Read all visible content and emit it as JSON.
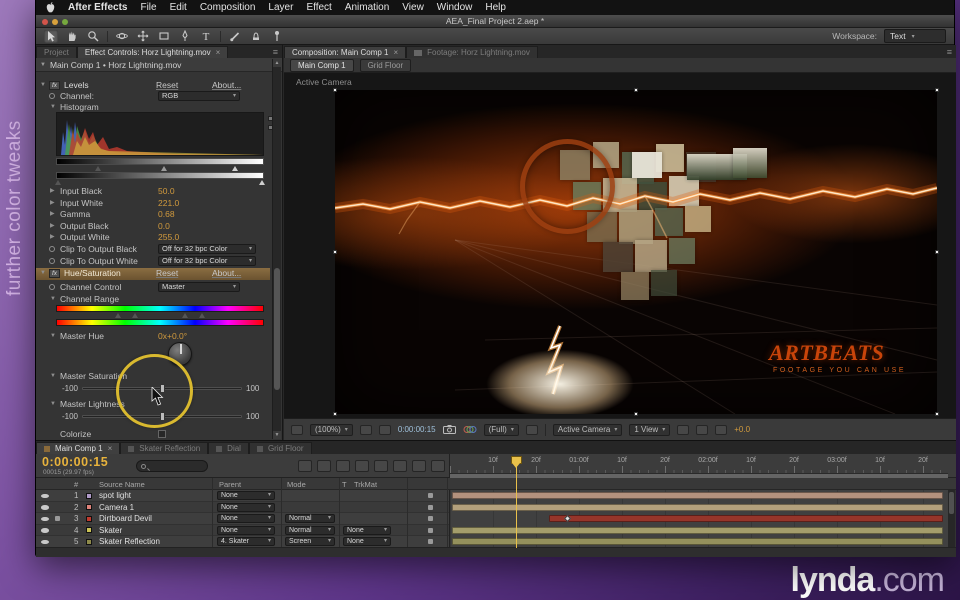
{
  "overlay": {
    "caption": "further color tweaks",
    "logo_main": "lynda",
    "logo_suffix": ".com"
  },
  "menubar": {
    "items": [
      "After Effects",
      "File",
      "Edit",
      "Composition",
      "Layer",
      "Effect",
      "Animation",
      "View",
      "Window",
      "Help"
    ]
  },
  "window": {
    "title": "AEA_Final Project 2.aep *"
  },
  "toolbar": {
    "workspace_label": "Workspace:",
    "workspace_value": "Text",
    "tools": [
      "selection-tool",
      "hand-tool",
      "zoom-tool",
      "orbit-camera-tool",
      "pan-behind-tool",
      "mask-shape-tool",
      "pen-tool",
      "type-tool",
      "brush-tool",
      "clone-stamp-tool",
      "puppet-pin-tool"
    ]
  },
  "effect_controls": {
    "tab_project": "Project",
    "tab_effect_controls": "Effect Controls: Horz Lightning.mov",
    "breadcrumb": "Main Comp 1 • Horz Lightning.mov",
    "levels": {
      "title": "Levels",
      "reset": "Reset",
      "about": "About...",
      "channel_label": "Channel:",
      "channel_value": "RGB",
      "histogram_label": "Histogram",
      "input_black_label": "Input Black",
      "input_black_value": "50.0",
      "input_white_label": "Input White",
      "input_white_value": "221.0",
      "gamma_label": "Gamma",
      "gamma_value": "0.68",
      "output_black_label": "Output Black",
      "output_black_value": "0.0",
      "output_white_label": "Output White",
      "output_white_value": "255.0",
      "clip_black_label": "Clip To Output Black",
      "clip_black_value": "Off for 32 bpc Color",
      "clip_white_label": "Clip To Output White",
      "clip_white_value": "Off for 32 bpc Color"
    },
    "hue_saturation": {
      "title": "Hue/Saturation",
      "reset": "Reset",
      "about": "About...",
      "channel_control_label": "Channel Control",
      "channel_control_value": "Master",
      "channel_range_label": "Channel Range",
      "master_hue_label": "Master Hue",
      "master_hue_value": "0x+0.0°",
      "master_saturation_label": "Master Saturation",
      "master_lightness_label": "Master Lightness",
      "slider_min": "-100",
      "slider_max": "100",
      "colorize_label": "Colorize"
    }
  },
  "composition": {
    "tab_active": "Composition: Main Comp 1",
    "tab_inactive": "Footage: Horz Lightning.mov",
    "nav_comp": "Main Comp 1",
    "nav_grid": "Grid Floor",
    "camera_label": "Active Camera",
    "watermark_title": "ARTBEATS",
    "watermark_subtitle": "FOOTAGE YOU CAN USE",
    "statusbar": {
      "zoom": "(100%)",
      "timecode": "0:00:00:15",
      "resolution": "(Full)",
      "camera": "Active Camera",
      "views": "1 View",
      "exposure": "+0.0"
    }
  },
  "timeline": {
    "tabs": [
      "Main Comp 1",
      "Skater Reflection",
      "Dial",
      "Grid Floor"
    ],
    "timecode": "0:00:00:15",
    "frame_info": "00015 (29.97 fps)",
    "columns": {
      "hash": "#",
      "source_name": "Source Name",
      "parent": "Parent",
      "mode": "Mode",
      "t": "T",
      "trkmat": "TrkMat"
    },
    "ruler_labels": [
      "10f",
      "20f",
      "01:00f",
      "10f",
      "20f",
      "02:00f",
      "10f",
      "20f",
      "03:00f",
      "10f",
      "20f"
    ],
    "layers": [
      {
        "num": "1",
        "name": "spot light",
        "parent": "None",
        "mode": "",
        "trkmat": "",
        "color": "#b09ac8",
        "bar_color": "#b3917d"
      },
      {
        "num": "2",
        "name": "Camera 1",
        "parent": "None",
        "mode": "",
        "trkmat": "",
        "color": "#e0837a",
        "bar_color": "#b3a07c"
      },
      {
        "num": "3",
        "name": "Dirtboard Devil",
        "parent": "None",
        "mode": "Normal",
        "trkmat": "",
        "color": "#c23b2e",
        "bar_color": "#96352a"
      },
      {
        "num": "4",
        "name": "Skater",
        "parent": "None",
        "mode": "Normal",
        "trkmat": "None",
        "color": "#cbc356",
        "bar_color": "#a49d6b"
      },
      {
        "num": "5",
        "name": "Skater Reflection",
        "parent": "4. Skater",
        "mode": "Screen",
        "trkmat": "None",
        "color": "#8e8a4a",
        "bar_color": "#94905c"
      }
    ]
  },
  "colors": {
    "value_accent": "#d19a3d",
    "timecode_accent": "#e8b33c",
    "annotation": "#d9b92f",
    "background_top": "#9d79bb",
    "background_bottom": "#2c1547"
  }
}
